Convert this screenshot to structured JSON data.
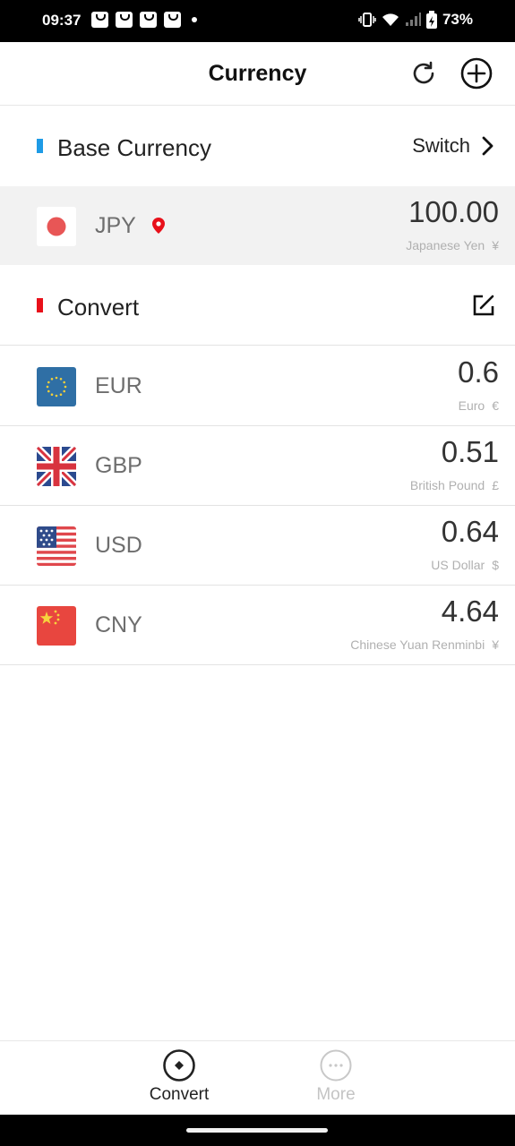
{
  "status_bar": {
    "time": "09:37",
    "battery_pct": "73%",
    "icons": [
      "shopping-bag-icon",
      "shopping-bag-icon",
      "shopping-bag-icon",
      "shopping-bag-icon",
      "dot-icon",
      "vibrate-icon",
      "wifi-icon",
      "signal-icon",
      "battery-charging-icon"
    ]
  },
  "app_bar": {
    "title": "Currency",
    "actions": [
      "refresh-icon",
      "add-circle-icon"
    ]
  },
  "base_section": {
    "title": "Base Currency",
    "switch_label": "Switch",
    "accent": "#1e9be6"
  },
  "base_currency": {
    "code": "JPY",
    "amount": "100.00",
    "name": "Japanese Yen",
    "symbol": "¥",
    "flag": "japan-flag-icon"
  },
  "convert_section": {
    "title": "Convert",
    "accent": "#e8101a",
    "action": "edit-icon"
  },
  "convert_list": [
    {
      "code": "EUR",
      "amount": "0.6",
      "name": "Euro",
      "symbol": "€",
      "flag": "eu-flag-icon"
    },
    {
      "code": "GBP",
      "amount": "0.51",
      "name": "British Pound",
      "symbol": "£",
      "flag": "uk-flag-icon"
    },
    {
      "code": "USD",
      "amount": "0.64",
      "name": "US Dollar",
      "symbol": "$",
      "flag": "us-flag-icon"
    },
    {
      "code": "CNY",
      "amount": "4.64",
      "name": "Chinese Yuan Renminbi",
      "symbol": "¥",
      "flag": "china-flag-icon"
    }
  ],
  "bottom_nav": {
    "items": [
      {
        "label": "Convert",
        "icon": "convert-icon",
        "active": true
      },
      {
        "label": "More",
        "icon": "more-icon",
        "active": false
      }
    ]
  },
  "colors": {
    "pin": "#e8101a",
    "base_row_bg": "#f2f2f2"
  }
}
